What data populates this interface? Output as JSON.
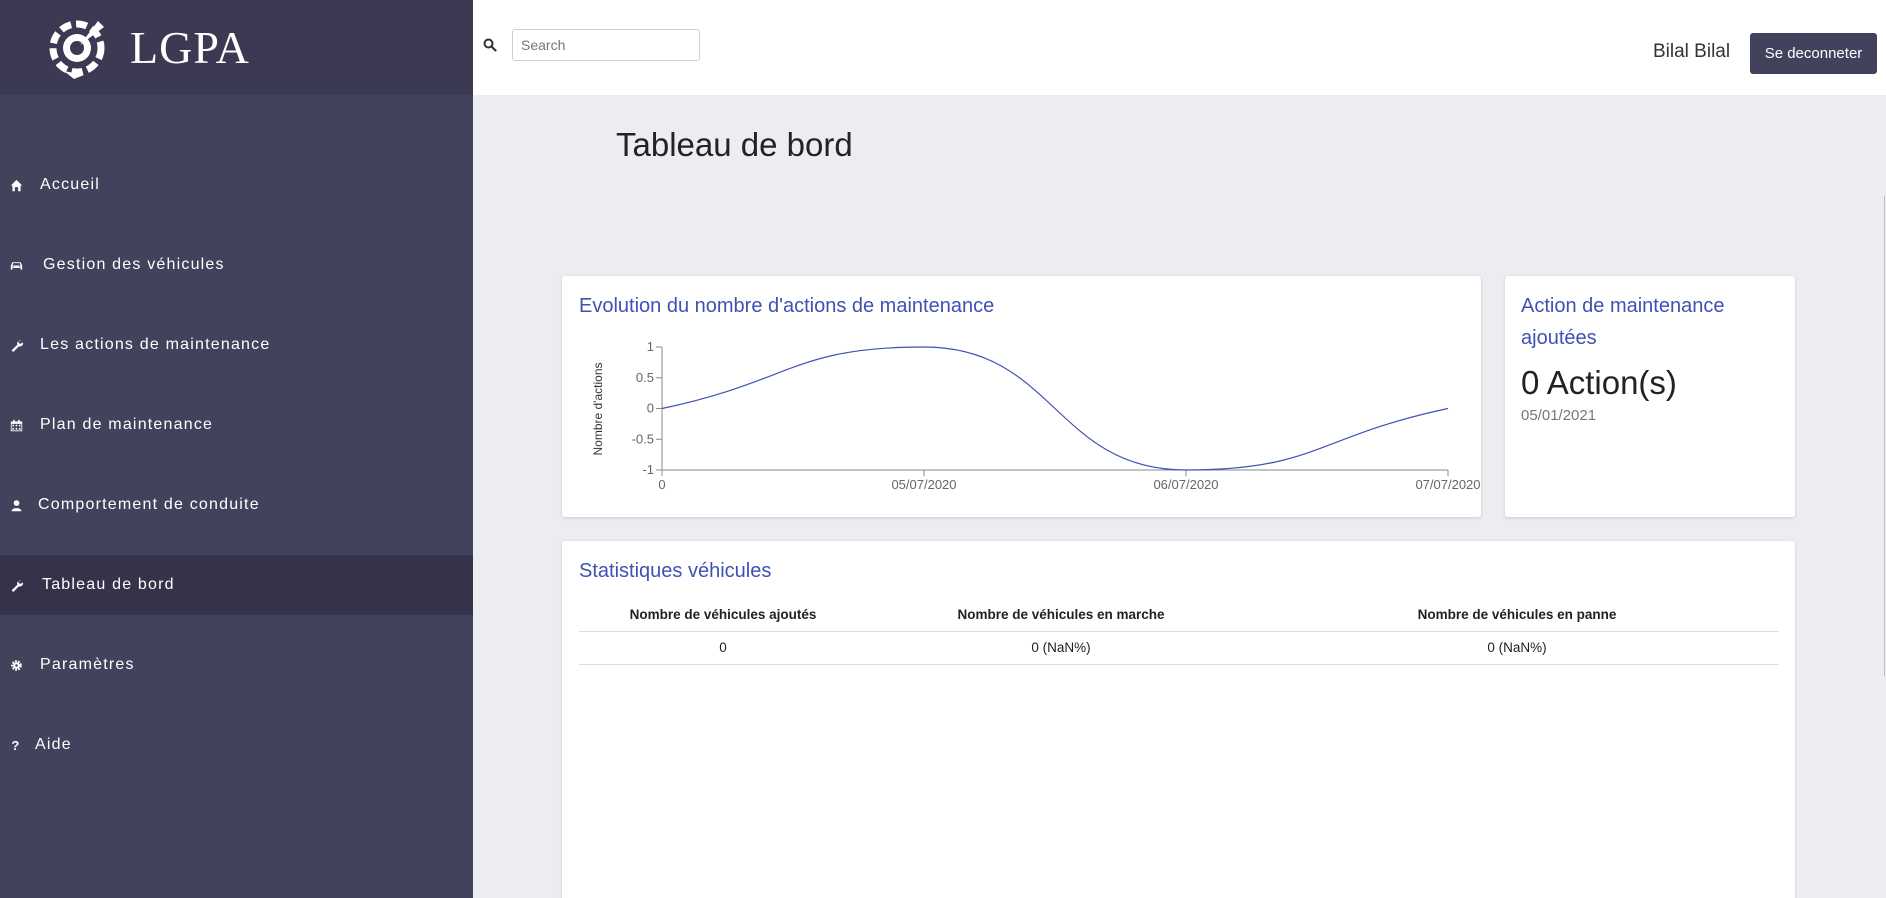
{
  "app": {
    "name": "LGPA"
  },
  "sidebar": {
    "items": [
      {
        "label": "Accueil",
        "icon": "home-icon"
      },
      {
        "label": "Gestion des véhicules",
        "icon": "car-icon"
      },
      {
        "label": "Les actions de maintenance",
        "icon": "wrench-icon"
      },
      {
        "label": "Plan de maintenance",
        "icon": "calendar-icon"
      },
      {
        "label": "Comportement de conduite",
        "icon": "user-icon"
      },
      {
        "label": "Tableau de bord",
        "icon": "wrench-icon",
        "active": true
      },
      {
        "label": "Paramètres",
        "icon": "gear-icon"
      },
      {
        "label": "Aide",
        "icon": "question-icon"
      }
    ]
  },
  "header": {
    "search_placeholder": "Search",
    "username": "Bilal Bilal",
    "logout_label": "Se deconneter"
  },
  "page": {
    "title": "Tableau de bord"
  },
  "chart_card": {
    "title": "Evolution du nombre d'actions de maintenance"
  },
  "chart_data": {
    "type": "line",
    "title": "Evolution du nombre d'actions de maintenance",
    "xlabel": "",
    "ylabel": "Nombre d'actions",
    "x_tick_labels": [
      "0",
      "05/07/2020",
      "06/07/2020",
      "07/07/2020"
    ],
    "y_tick_labels": [
      "1",
      "0.5",
      "0",
      "-0.5",
      "-1"
    ],
    "ylim": [
      -1,
      1
    ],
    "series": [
      {
        "points": [
          [
            0,
            0
          ],
          [
            1,
            1
          ],
          [
            2,
            -1
          ],
          [
            3,
            0
          ]
        ]
      }
    ],
    "line_color": "#3f51b5",
    "grid": false
  },
  "action_card": {
    "title": "Action de maintenance ajoutées",
    "count": "0 Action(s)",
    "date": "05/01/2021"
  },
  "stats_card": {
    "title": "Statistiques véhicules",
    "columns": [
      "Nombre de véhicules ajoutés",
      "Nombre de véhicules en marche",
      "Nombre de véhicules en panne"
    ],
    "rows": [
      [
        "0",
        "0 (NaN%)",
        "0 (NaN%)"
      ]
    ]
  },
  "colors": {
    "sidebar": "#43425d",
    "accent": "#3f51b5",
    "background": "#ecedf1"
  }
}
